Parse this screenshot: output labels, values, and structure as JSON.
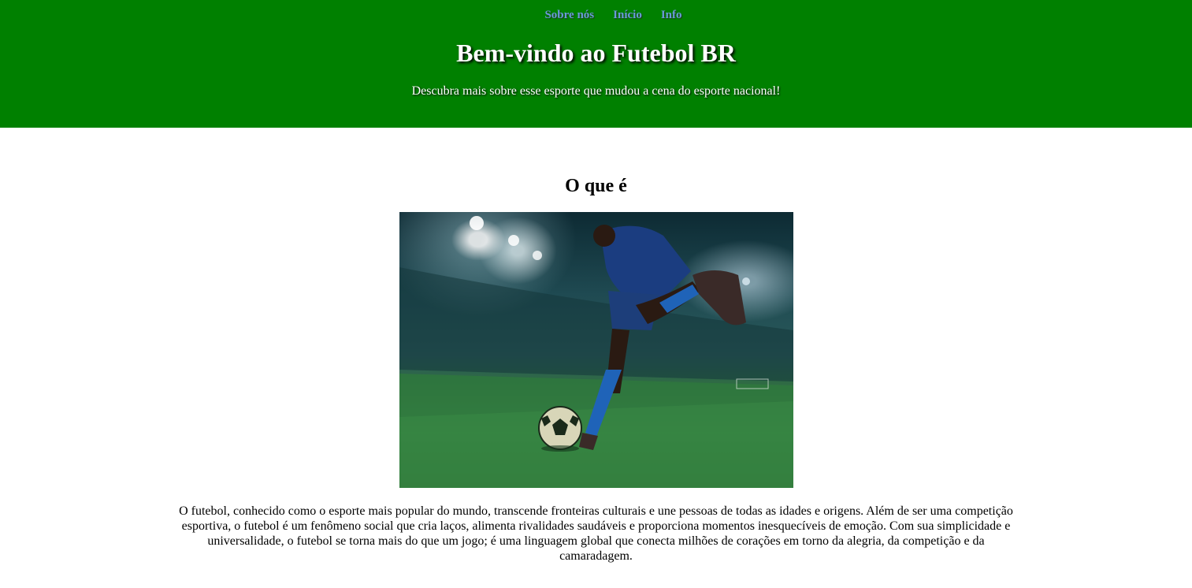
{
  "nav": {
    "items": [
      {
        "label": "Sobre nós"
      },
      {
        "label": "Início"
      },
      {
        "label": "Info"
      }
    ]
  },
  "hero": {
    "title": "Bem-vindo ao Futebol BR",
    "subtitle": "Descubra mais sobre esse esporte que mudou a cena do esporte nacional!"
  },
  "section": {
    "title": "O que é",
    "paragraph": "O futebol, conhecido como o esporte mais popular do mundo, transcende fronteiras culturais e une pessoas de todas as idades e origens. Além de ser uma competição esportiva, o futebol é um fenômeno social que cria laços, alimenta rivalidades saudáveis e proporciona momentos inesquecíveis de emoção. Com sua simplicidade e universalidade, o futebol se torna mais do que um jogo; é uma linguagem global que conecta milhões de corações em torno da alegria, da competição e da camaradagem."
  },
  "colors": {
    "header_bg": "#008000",
    "nav_link": "#6a9bd8",
    "text": "#000000"
  }
}
